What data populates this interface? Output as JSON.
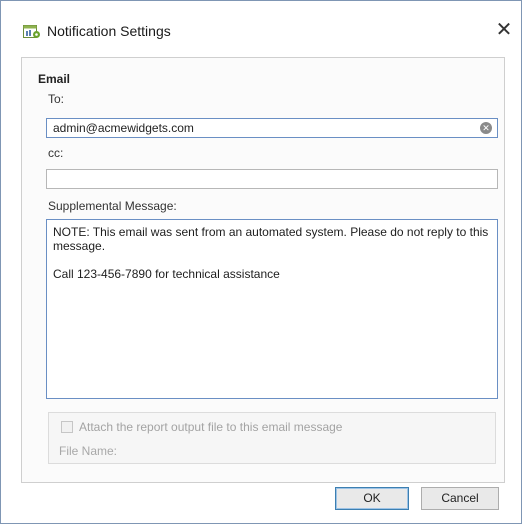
{
  "window": {
    "title": "Notification Settings",
    "close_glyph": "✕",
    "app_icon": "report-settings-icon"
  },
  "email": {
    "group_title": "Email",
    "to_label": "To:",
    "to_value": "admin@acmewidgets.com",
    "cc_label": "cc:",
    "cc_value": "",
    "supplemental_label": "Supplemental Message:",
    "message_lines": [
      "NOTE: This email was sent from an automated system. Please do not reply to this message.",
      "Call 123-456-7890 for technical assistance"
    ]
  },
  "attachment": {
    "checkbox_label": "Attach the report output file to this email message",
    "checked": false,
    "file_name_label": "File Name:"
  },
  "buttons": {
    "ok": "OK",
    "cancel": "Cancel"
  },
  "colors": {
    "accent": "#3c7fb1",
    "focus_border": "#6a8fc4",
    "disabled_text": "#a3a3a3"
  }
}
